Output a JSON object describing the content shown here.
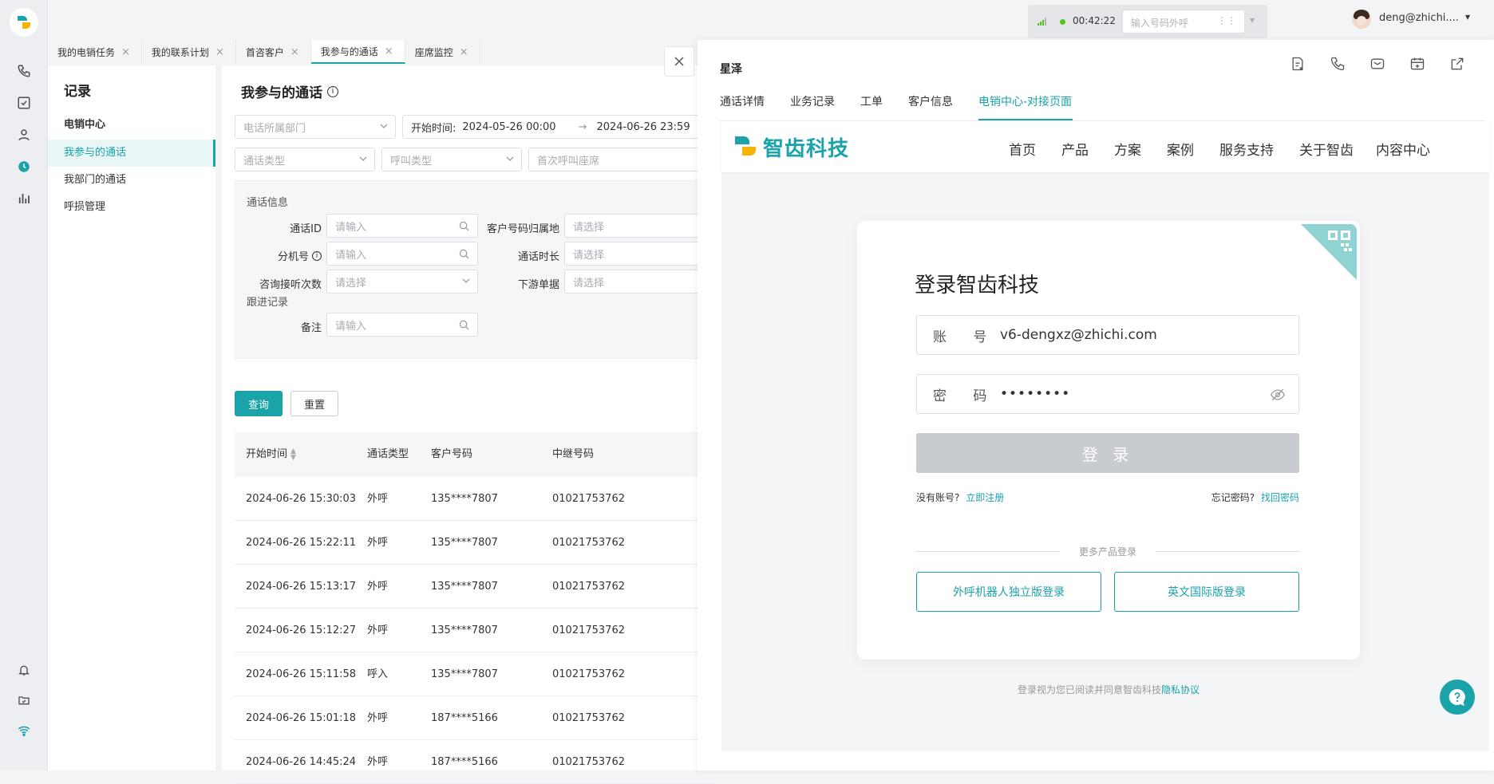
{
  "user": {
    "name": "deng@zhichi...."
  },
  "callbar": {
    "timer": "00:42:22",
    "placeholder": "输入号码外呼"
  },
  "tabs": [
    {
      "label": "我的电销任务"
    },
    {
      "label": "我的联系计划"
    },
    {
      "label": "首咨客户"
    },
    {
      "label": "我参与的通话"
    },
    {
      "label": "座席监控"
    }
  ],
  "subnav": {
    "title": "记录",
    "items": [
      {
        "label": "电销中心"
      },
      {
        "label": "我参与的通话"
      },
      {
        "label": "我部门的通话"
      },
      {
        "label": "呼损管理"
      }
    ]
  },
  "main": {
    "title": "我参与的通话",
    "filters": {
      "dept": "电话所属部门",
      "start_label": "开始时间:",
      "start": "2024-05-26 00:00",
      "arrow": "→",
      "end": "2024-06-26 23:59",
      "call_type": "通话类型",
      "dial_type": "呼叫类型",
      "first_agent": "首次呼叫座席"
    },
    "section_call": "通话信息",
    "section_follow": "跟进记录",
    "labels": {
      "call_id": "通话ID",
      "ext": "分机号",
      "consult": "咨询接听次数",
      "cust_loc": "客户号码归属地",
      "duration": "通话时长",
      "downstream": "下游单据",
      "remark": "备注"
    },
    "placeholders": {
      "input": "请输入",
      "select": "请选择"
    },
    "buttons": {
      "query": "查询",
      "reset": "重置"
    },
    "table": {
      "headers": [
        "开始时间",
        "通话类型",
        "客户号码",
        "中继号码"
      ],
      "rows": [
        [
          "2024-06-26 15:30:03",
          "外呼",
          "135****7807",
          "01021753762"
        ],
        [
          "2024-06-26 15:22:11",
          "外呼",
          "135****7807",
          "01021753762"
        ],
        [
          "2024-06-26 15:13:17",
          "外呼",
          "135****7807",
          "01021753762"
        ],
        [
          "2024-06-26 15:12:27",
          "外呼",
          "135****7807",
          "01021753762"
        ],
        [
          "2024-06-26 15:11:58",
          "呼入",
          "135****7807",
          "01021753762"
        ],
        [
          "2024-06-26 15:01:18",
          "外呼",
          "187****5166",
          "01021753762"
        ],
        [
          "2024-06-26 14:45:24",
          "外呼",
          "187****5166",
          "01021753762"
        ]
      ]
    }
  },
  "panel": {
    "name": "星泽",
    "tabs": [
      "通话详情",
      "业务记录",
      "工单",
      "客户信息",
      "电销中心-对接页面"
    ],
    "site": {
      "brand": "智齿科技",
      "nav": [
        "首页",
        "产品",
        "方案",
        "案例",
        "服务支持",
        "关于智齿",
        "内容中心"
      ],
      "login_title": "登录智齿科技",
      "account_label": "账 号",
      "account_value": "v6-dengxz@zhichi.com",
      "password_label": "密 码",
      "password_value": "••••••••",
      "login_btn": "登 录",
      "no_account": "没有账号?",
      "register": "立即注册",
      "forgot": "忘记密码?",
      "recover": "找回密码",
      "more": "更多产品登录",
      "robot_login": "外呼机器人独立版登录",
      "intl_login": "英文国际版登录",
      "agree": "登录视为您已阅读并同意智齿科技",
      "privacy": "隐私协议"
    }
  },
  "colors": {
    "accent": "#1aa3a9",
    "brand_yellow": "#f5b400"
  }
}
